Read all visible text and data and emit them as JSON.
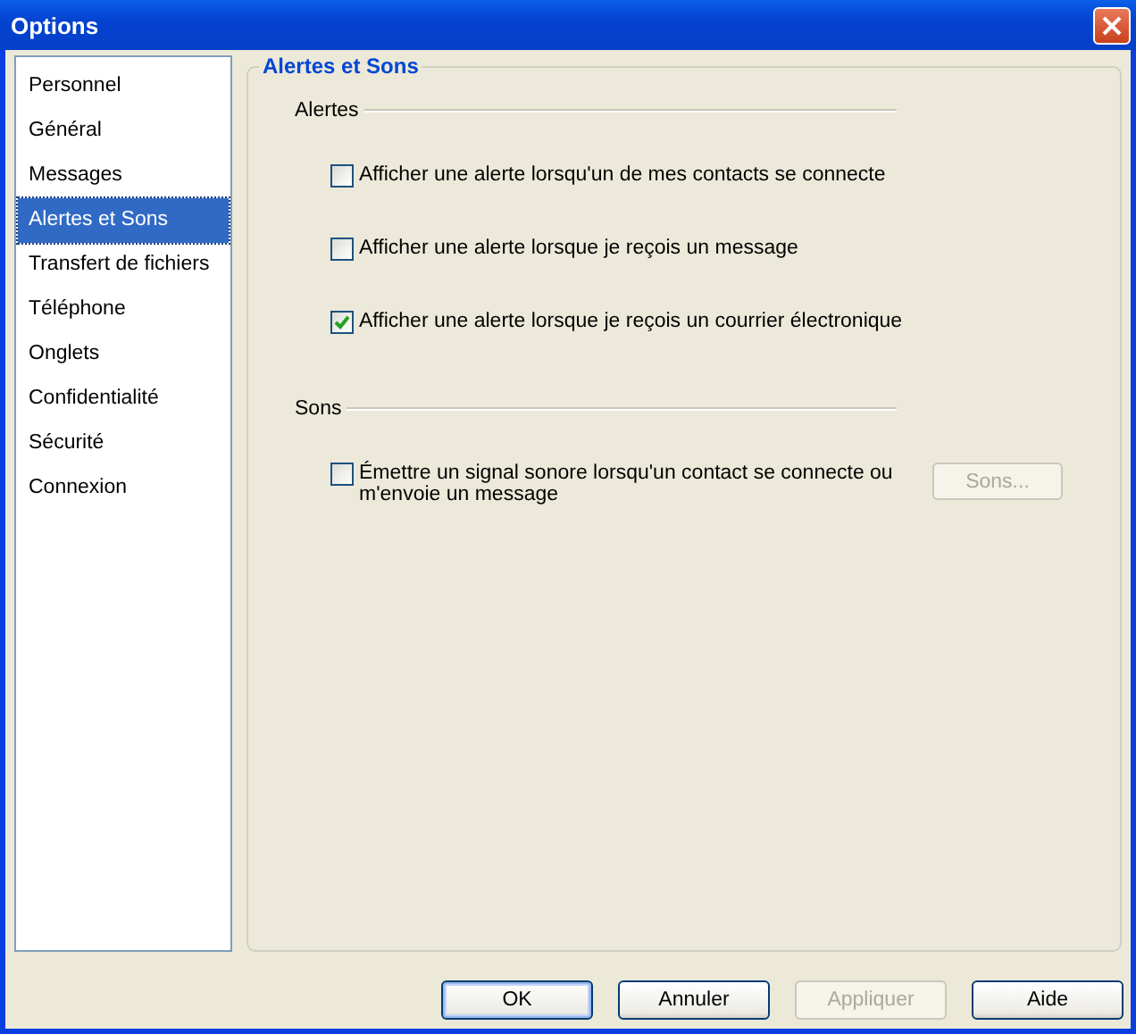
{
  "window": {
    "title": "Options"
  },
  "sidebar": {
    "items": [
      {
        "label": "Personnel",
        "selected": false
      },
      {
        "label": "Général",
        "selected": false
      },
      {
        "label": "Messages",
        "selected": false
      },
      {
        "label": "Alertes et Sons",
        "selected": true
      },
      {
        "label": "Transfert de fichiers",
        "selected": false
      },
      {
        "label": "Téléphone",
        "selected": false
      },
      {
        "label": "Onglets",
        "selected": false
      },
      {
        "label": "Confidentialité",
        "selected": false
      },
      {
        "label": "Sécurité",
        "selected": false
      },
      {
        "label": "Connexion",
        "selected": false
      }
    ]
  },
  "panel": {
    "title": "Alertes et Sons",
    "sections": [
      {
        "label": "Alertes",
        "options": [
          {
            "label": "Afficher une alerte lorsqu'un de mes contacts se connecte",
            "checked": false
          },
          {
            "label": "Afficher une alerte lorsque je reçois un message",
            "checked": false
          },
          {
            "label": "Afficher une alerte lorsque je reçois un courrier électronique",
            "checked": true
          }
        ]
      },
      {
        "label": "Sons",
        "options": [
          {
            "label": "Émettre un signal sonore lorsqu'un contact se connecte ou m'envoie un message",
            "checked": false,
            "button": {
              "label": "Sons...",
              "disabled": true
            }
          }
        ]
      }
    ]
  },
  "buttons": [
    {
      "label": "OK",
      "disabled": false,
      "default": true
    },
    {
      "label": "Annuler",
      "disabled": false,
      "default": false
    },
    {
      "label": "Appliquer",
      "disabled": true,
      "default": false
    },
    {
      "label": "Aide",
      "disabled": false,
      "default": false
    }
  ]
}
